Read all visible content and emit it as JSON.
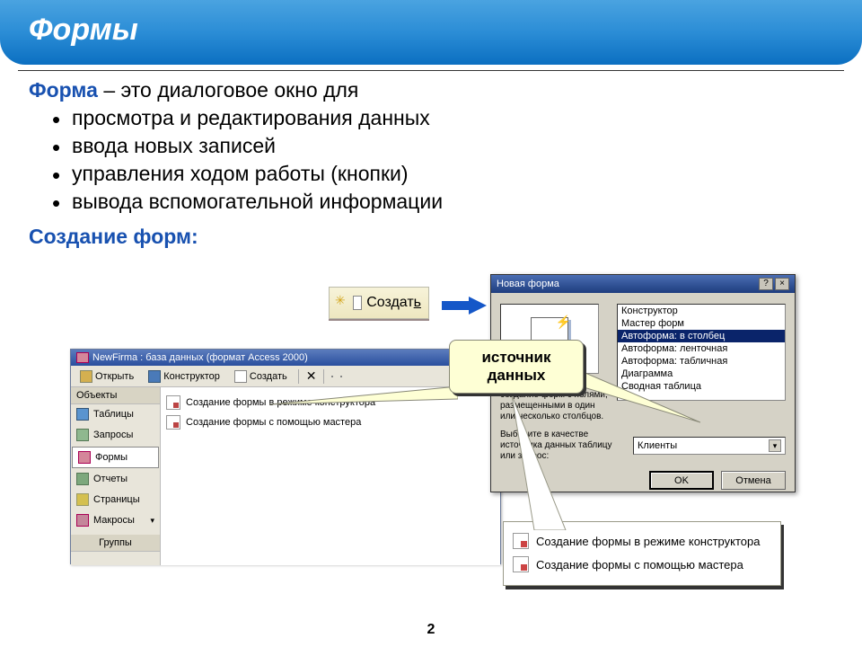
{
  "header": {
    "title": "Формы"
  },
  "definition": {
    "term": "Форма",
    "rest": " – это диалоговое окно для"
  },
  "bullets": [
    "просмотра и редактирования данных",
    "ввода новых записей",
    "управления ходом работы (кнопки)",
    "вывода вспомогательной информации"
  ],
  "sub_heading": "Создание форм:",
  "create_button": {
    "label_prefix": "Создат",
    "label_u": "ь"
  },
  "dbwin": {
    "title": "NewFirma : база данных (формат Access 2000)",
    "toolbar": {
      "open": "Открыть",
      "designer": "Конструктор",
      "create": "Создать"
    },
    "side_header": "Объекты",
    "side_items": [
      "Таблицы",
      "Запросы",
      "Формы",
      "Отчеты",
      "Страницы",
      "Макросы"
    ],
    "side_footer": "Группы",
    "main_items": [
      "Создание формы в режиме конструктора",
      "Создание формы с помощью мастера"
    ]
  },
  "newform": {
    "title": "Новая форма",
    "list": [
      "Конструктор",
      "Мастер форм",
      "Автоформа: в столбец",
      "Автоформа: ленточная",
      "Автоформа: табличная",
      "Диаграмма",
      "Сводная таблица"
    ],
    "selected_index": 2,
    "desc": "Автоматическое создание форм с полями, размещенными в один или несколько столбцов.",
    "bottom_label": "Выберите в качестве источника данных таблицу или запрос:",
    "select_value": "Клиенты",
    "ok": "OK",
    "cancel": "Отмена",
    "help": "?",
    "close": "×"
  },
  "callout": {
    "line1": "источник",
    "line2": "данных"
  },
  "popup2": [
    "Создание формы в режиме конструктора",
    "Создание формы с помощью мастера"
  ],
  "page_number": "2"
}
